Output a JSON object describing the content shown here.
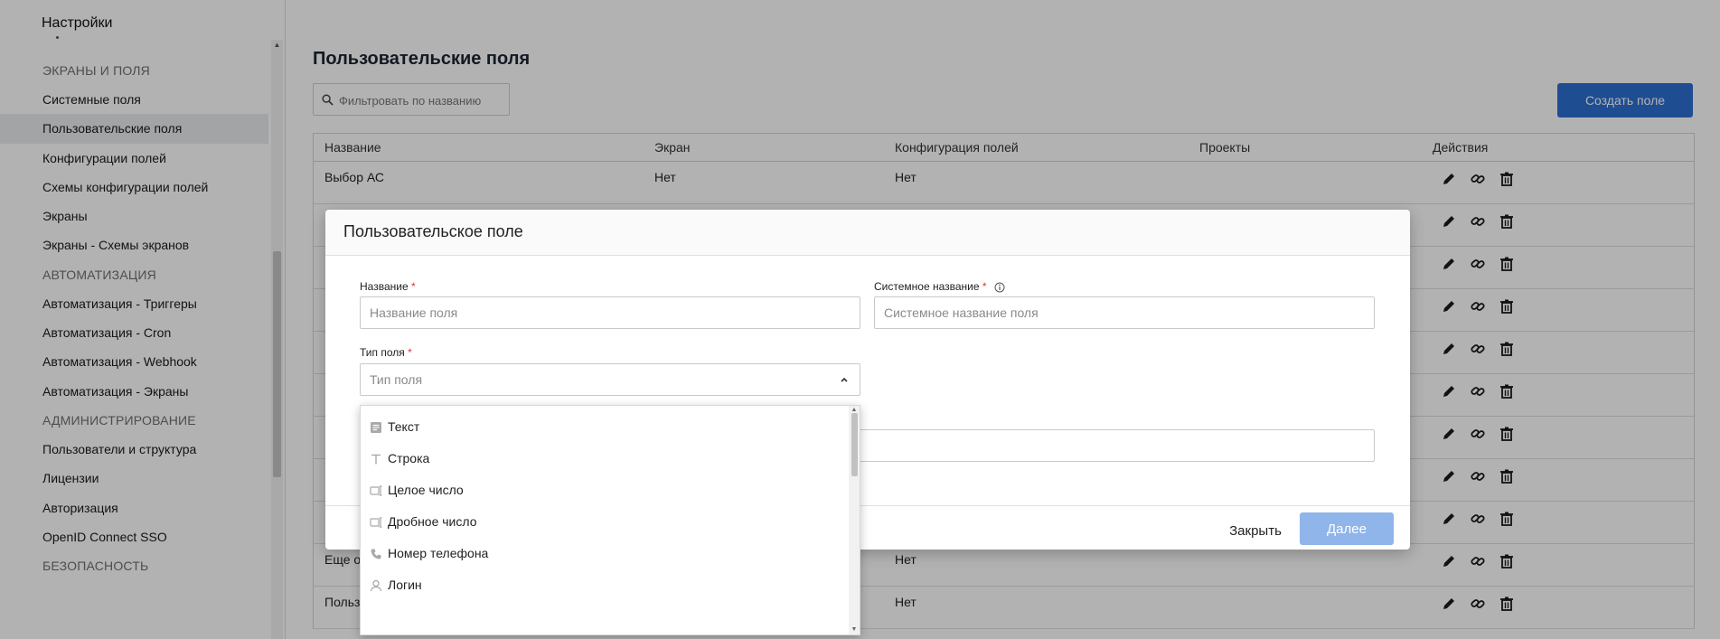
{
  "sidebar": {
    "title": "Настройки",
    "sections": [
      {
        "heading": "ЭКРАНЫ И ПОЛЯ",
        "items": [
          "Системные поля",
          "Пользовательские поля",
          "Конфигурации полей",
          "Схемы конфигурации полей",
          "Экраны",
          "Экраны - Схемы экранов"
        ]
      },
      {
        "heading": "АВТОМАТИЗАЦИЯ",
        "items": [
          "Автоматизация - Триггеры",
          "Автоматизация - Cron",
          "Автоматизация - Webhook",
          "Автоматизация - Экраны"
        ]
      },
      {
        "heading": "АДМИНИСТРИРОВАНИЕ",
        "items": [
          "Пользователи и структура",
          "Лицензии",
          "Авторизация",
          "OpenID Connect SSO"
        ]
      },
      {
        "heading": "БЕЗОПАСНОСТЬ",
        "items": []
      }
    ],
    "active_item": "Пользовательские поля"
  },
  "main": {
    "title": "Пользовательские поля",
    "filter_placeholder": "Фильтровать по названию",
    "create_button": "Создать поле",
    "table": {
      "columns": [
        "Название",
        "Экран",
        "Конфигурация полей",
        "Проекты",
        "Действия"
      ],
      "rows": [
        {
          "name": "Выбор АС",
          "screen": "Нет",
          "config": "Нет",
          "projects": ""
        },
        {
          "name": "",
          "screen": "",
          "config": "",
          "projects": ""
        },
        {
          "name": "",
          "screen": "",
          "config": "",
          "projects": ""
        },
        {
          "name": "",
          "screen": "",
          "config": "",
          "projects": ""
        },
        {
          "name": "",
          "screen": "",
          "config": "",
          "projects": ""
        },
        {
          "name": "",
          "screen": "",
          "config": "",
          "projects": ""
        },
        {
          "name": "",
          "screen": "",
          "config": "",
          "projects": ""
        },
        {
          "name": "",
          "screen": "",
          "config": "",
          "projects": ""
        },
        {
          "name": "",
          "screen": "",
          "config": "",
          "projects": ""
        },
        {
          "name": "Еще од",
          "screen": "",
          "config": "Нет",
          "projects": ""
        },
        {
          "name": "Польз",
          "screen": "",
          "config": "Нет",
          "projects": ""
        }
      ]
    }
  },
  "modal": {
    "title": "Пользовательское поле",
    "name_label": "Название",
    "name_placeholder": "Название поля",
    "system_name_label": "Системное название",
    "system_name_placeholder": "Системное название поля",
    "type_label": "Тип поля",
    "type_placeholder": "Тип поля",
    "required_mark": "*",
    "close_button": "Закрыть",
    "next_button": "Далее"
  },
  "dropdown": {
    "options": [
      {
        "label": "Текст",
        "icon": "text-block-icon"
      },
      {
        "label": "Строка",
        "icon": "text-t-icon"
      },
      {
        "label": "Целое число",
        "icon": "integer-icon"
      },
      {
        "label": "Дробное число",
        "icon": "decimal-icon"
      },
      {
        "label": "Номер телефона",
        "icon": "phone-icon"
      },
      {
        "label": "Логин",
        "icon": "user-icon"
      }
    ]
  },
  "colors": {
    "primary": "#2d6fd2",
    "primary_disabled": "#8fb5ea",
    "required": "#d9363e",
    "active_item_bg": "#e9ebee"
  }
}
